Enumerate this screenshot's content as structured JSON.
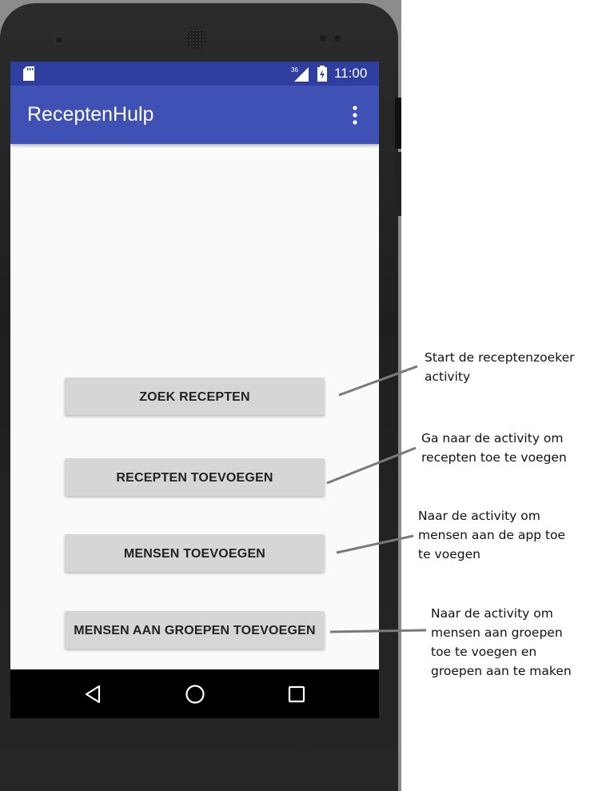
{
  "status_bar": {
    "network": "36",
    "time": "11:00"
  },
  "app_bar": {
    "title": "ReceptenHulp"
  },
  "buttons": [
    {
      "label": "ZOEK RECEPTEN"
    },
    {
      "label": "RECEPTEN TOEVOEGEN"
    },
    {
      "label": "MENSEN TOEVOEGEN"
    },
    {
      "label": "MENSEN AAN GROEPEN TOEVOEGEN"
    }
  ],
  "annotations": [
    {
      "lines": [
        "Start de receptenzoeker",
        "activity"
      ]
    },
    {
      "lines": [
        "Ga naar de activity om",
        "recepten toe te voegen"
      ]
    },
    {
      "lines": [
        "Naar de activity om",
        "mensen aan de app toe",
        "te voegen"
      ]
    },
    {
      "lines": [
        "Naar de activity om",
        "mensen aan groepen",
        "toe te voegen en",
        "groepen aan te maken"
      ]
    }
  ],
  "icons": {
    "status": [
      "sd-card-icon",
      "signal-icon",
      "battery-icon"
    ],
    "app_bar": [
      "overflow-menu-icon"
    ],
    "nav": [
      "back-icon",
      "home-icon",
      "recents-icon"
    ]
  },
  "colors": {
    "status_bar": "#303f9f",
    "app_bar": "#3f51b5",
    "button": "#d6d6d6",
    "screen_bg": "#fafafa",
    "leader_line": "#7a7a7a"
  }
}
